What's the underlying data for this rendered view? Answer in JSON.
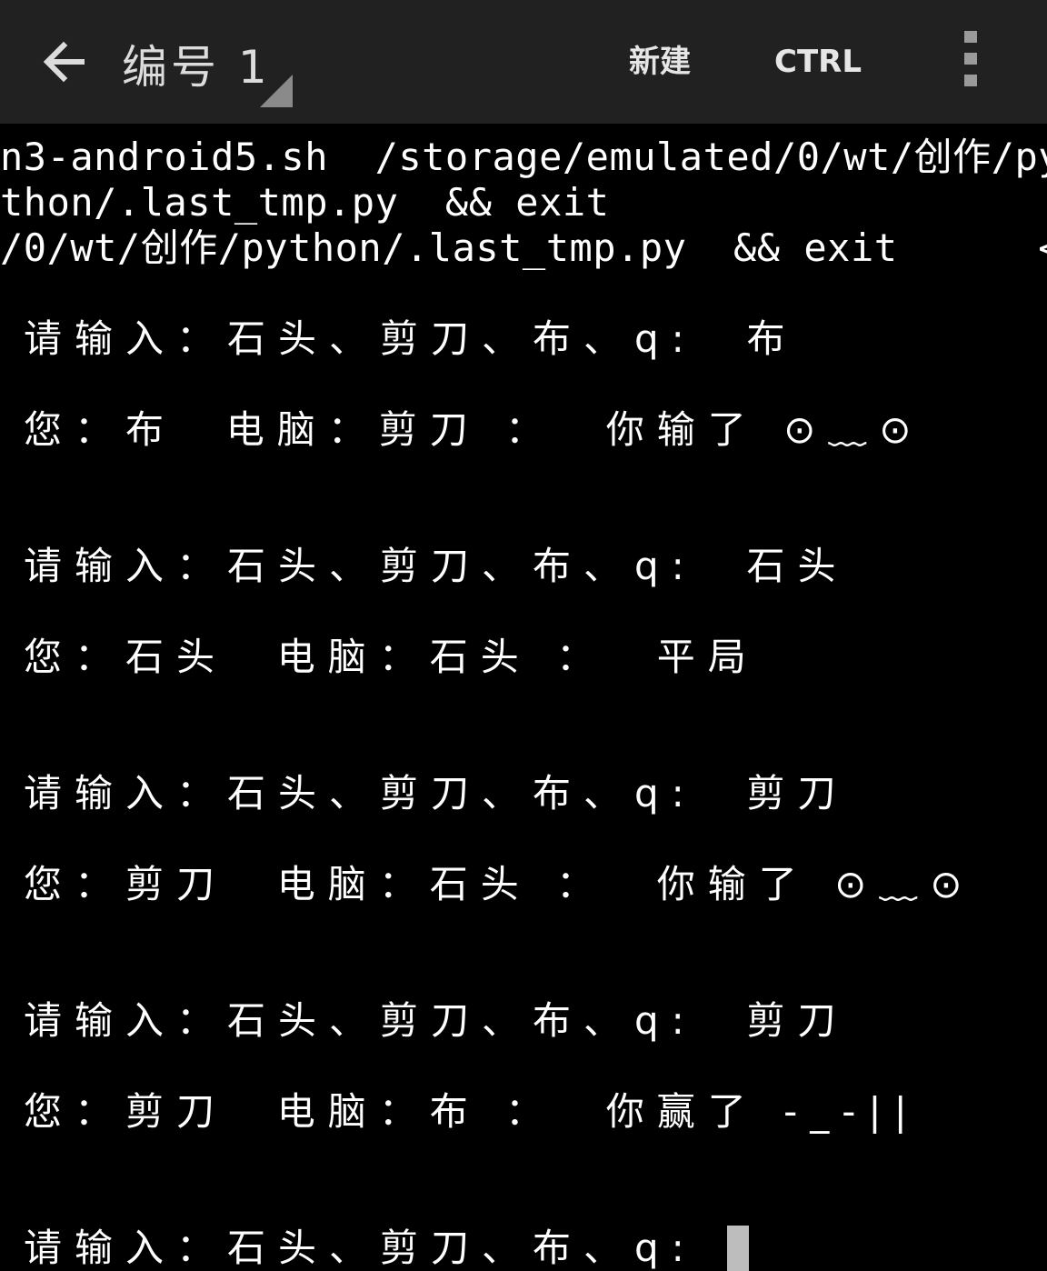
{
  "toolbar": {
    "title": "编号 1",
    "new_label": "新建",
    "ctrl_label": "CTRL",
    "background": "#212121",
    "back_icon": "arrow-left-icon",
    "menu_icon": "overflow-menu-icon"
  },
  "terminal": {
    "background": "#000000",
    "text_color": "#ffffff",
    "cursor_color": "#bdbdbd",
    "header_lines": [
      "n3-android5.sh  /storage/emulated/0/wt/创作/py",
      "thon/.last_tmp.py  && exit",
      "/0/wt/创作/python/.last_tmp.py  && exit      <"
    ],
    "rounds": [
      {
        "prompt": "请输入：石头、剪刀、布、q:  布",
        "result": "您：布  电脑：剪刀 ：  你输了 ⊙﹏⊙"
      },
      {
        "prompt": "请输入：石头、剪刀、布、q:  石头",
        "result": "您：石头  电脑：石头 ：  平局"
      },
      {
        "prompt": "请输入：石头、剪刀、布、q:  剪刀",
        "result": "您：剪刀  电脑：石头 ：  你输了 ⊙﹏⊙"
      },
      {
        "prompt": "请输入：石头、剪刀、布、q:  剪刀",
        "result": "您：剪刀  电脑：布 ：  你赢了 -_-||"
      }
    ],
    "final_prompt": "请输入：石头、剪刀、布、q: "
  }
}
